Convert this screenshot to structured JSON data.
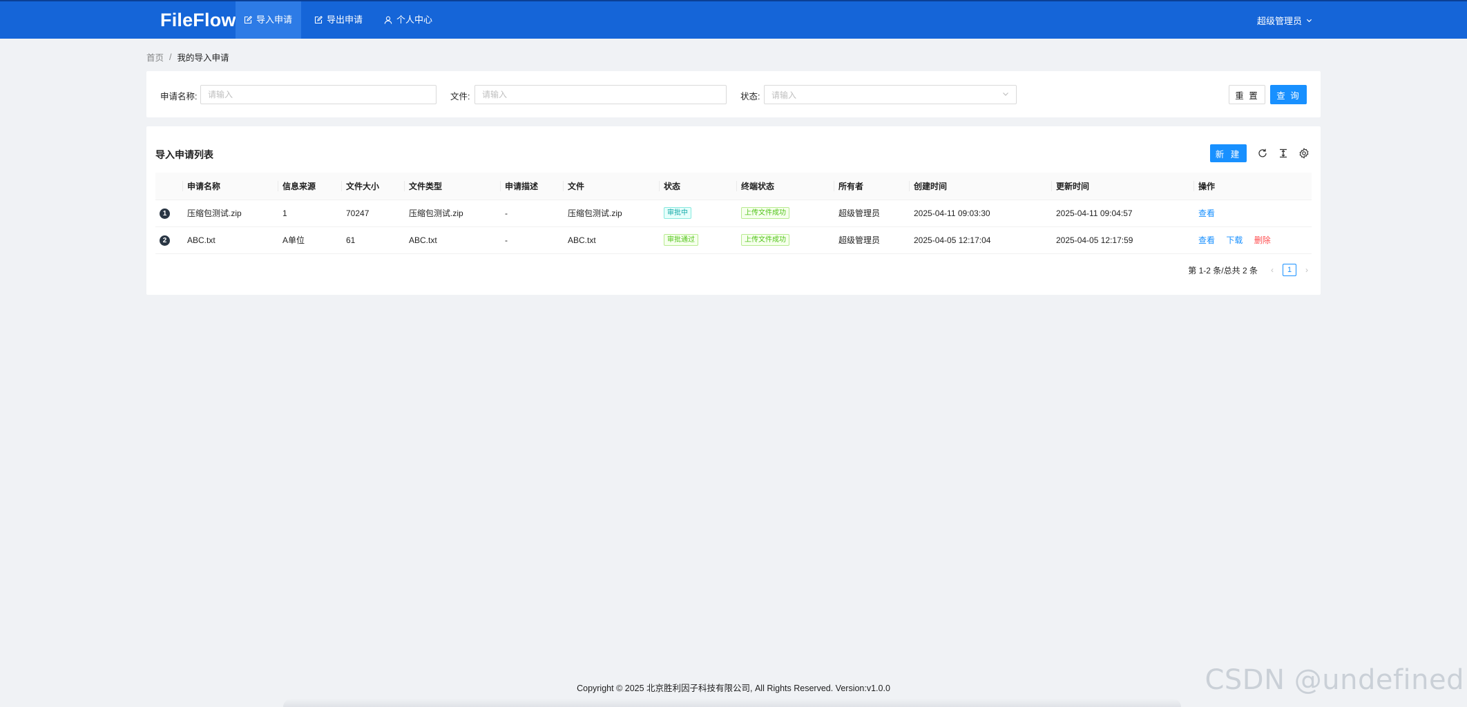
{
  "header": {
    "brand": "FileFlow",
    "nav": [
      {
        "label": "导入申请",
        "icon": "edit-square-icon",
        "active": true
      },
      {
        "label": "导出申请",
        "icon": "edit-square-icon",
        "active": false
      },
      {
        "label": "个人中心",
        "icon": "user-icon",
        "active": false
      }
    ],
    "user": {
      "name": "超级管理员",
      "icon": "chevron-down-icon"
    }
  },
  "breadcrumb": {
    "home": "首页",
    "separator": "/",
    "current": "我的导入申请"
  },
  "search": {
    "name_label": "申请名称:",
    "name_placeholder": "请输入",
    "file_label": "文件:",
    "file_placeholder": "请输入",
    "status_label": "状态:",
    "status_placeholder": "请输入",
    "reset_label": "重 置",
    "query_label": "查 询"
  },
  "table": {
    "title": "导入申请列表",
    "new_label": "新 建",
    "tool_icons": [
      "reload-icon",
      "column-height-icon",
      "setting-icon"
    ],
    "columns": [
      "",
      "申请名称",
      "信息来源",
      "文件大小",
      "文件类型",
      "申请描述",
      "文件",
      "状态",
      "终端状态",
      "所有者",
      "创建时间",
      "更新时间",
      "操作"
    ],
    "rows": [
      {
        "index": "1",
        "name": "压缩包测试.zip",
        "source": "1",
        "size": "70247",
        "type": "压缩包测试.zip",
        "description": "-",
        "file": "压缩包测试.zip",
        "status": "审批中",
        "status_color": "#13a8a8",
        "terminal_status": "上传文件成功",
        "owner": "超级管理员",
        "created": "2025-04-11 09:03:30",
        "updated": "2025-04-11 09:04:57",
        "actions": [
          "查看"
        ]
      },
      {
        "index": "2",
        "name": "ABC.txt",
        "source": "A单位",
        "size": "61",
        "type": "ABC.txt",
        "description": "-",
        "file": "ABC.txt",
        "status": "审批通过",
        "status_color": "#52c41a",
        "terminal_status": "上传文件成功",
        "owner": "超级管理员",
        "created": "2025-04-05 12:17:04",
        "updated": "2025-04-05 12:17:59",
        "actions": [
          "查看",
          "下载",
          "删除"
        ]
      }
    ]
  },
  "pagination": {
    "summary": "第 1-2 条/总共 2 条",
    "current_page": "1",
    "prev": "‹",
    "next": "›"
  },
  "footer": "Copyright © 2025 北京胜利因子科技有限公司, All Rights Reserved. Version:v1.0.0",
  "watermark": "CSDN @undefined",
  "colors": {
    "header": "#1565d8",
    "primary": "#1890ff",
    "danger": "#ff4d4f"
  }
}
